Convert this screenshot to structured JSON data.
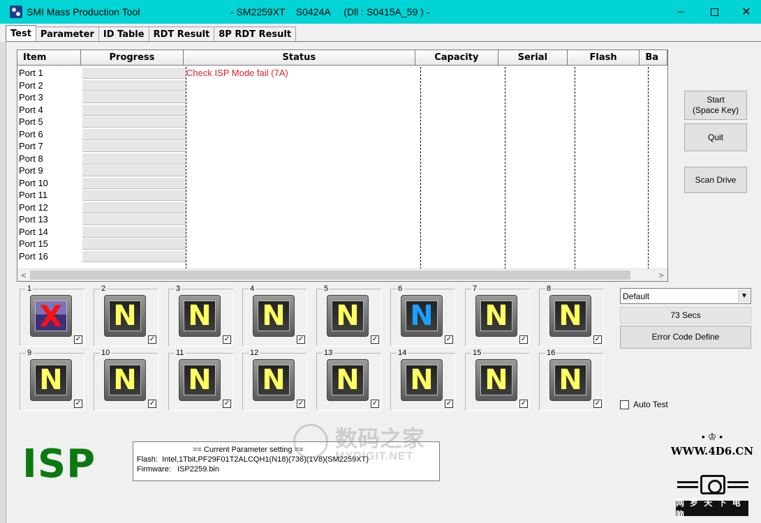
{
  "window": {
    "title": "SMI Mass Production Tool",
    "title_info": "- SM2259XT    S0424A     (Dll : S0415A_59 ) -",
    "minimize": "–",
    "close": "✕"
  },
  "tabs": [
    "Test",
    "Parameter",
    "ID Table",
    "RDT Result",
    "8P RDT Result"
  ],
  "grid": {
    "columns": [
      "Item",
      "Progress",
      "Status",
      "Capacity",
      "Serial",
      "Flash",
      "Ba"
    ],
    "rows": [
      {
        "item": "Port 1",
        "status": "Check ISP Mode fail (7A)"
      },
      {
        "item": "Port 2",
        "status": ""
      },
      {
        "item": "Port 3",
        "status": ""
      },
      {
        "item": "Port 4",
        "status": ""
      },
      {
        "item": "Port 5",
        "status": ""
      },
      {
        "item": "Port 6",
        "status": ""
      },
      {
        "item": "Port 7",
        "status": ""
      },
      {
        "item": "Port 8",
        "status": ""
      },
      {
        "item": "Port 9",
        "status": ""
      },
      {
        "item": "Port 10",
        "status": ""
      },
      {
        "item": "Port 11",
        "status": ""
      },
      {
        "item": "Port 12",
        "status": ""
      },
      {
        "item": "Port 13",
        "status": ""
      },
      {
        "item": "Port 14",
        "status": ""
      },
      {
        "item": "Port 15",
        "status": ""
      },
      {
        "item": "Port 16",
        "status": ""
      }
    ],
    "scroll_left": "<",
    "scroll_right": ">"
  },
  "buttons": {
    "start_line1": "Start",
    "start_line2": "(Space Key)",
    "quit": "Quit",
    "scan": "Scan Drive",
    "error_code": "Error Code Define"
  },
  "slots": [
    {
      "num": "1",
      "mark": "X",
      "state": "fail"
    },
    {
      "num": "2",
      "mark": "N",
      "state": "normal"
    },
    {
      "num": "3",
      "mark": "N",
      "state": "normal"
    },
    {
      "num": "4",
      "mark": "N",
      "state": "normal"
    },
    {
      "num": "5",
      "mark": "N",
      "state": "normal"
    },
    {
      "num": "6",
      "mark": "N",
      "state": "blue"
    },
    {
      "num": "7",
      "mark": "N",
      "state": "normal"
    },
    {
      "num": "8",
      "mark": "N",
      "state": "normal"
    },
    {
      "num": "9",
      "mark": "N",
      "state": "normal"
    },
    {
      "num": "10",
      "mark": "N",
      "state": "normal"
    },
    {
      "num": "11",
      "mark": "N",
      "state": "normal"
    },
    {
      "num": "12",
      "mark": "N",
      "state": "normal"
    },
    {
      "num": "13",
      "mark": "N",
      "state": "normal"
    },
    {
      "num": "14",
      "mark": "N",
      "state": "normal"
    },
    {
      "num": "15",
      "mark": "N",
      "state": "normal"
    },
    {
      "num": "16",
      "mark": "N",
      "state": "normal"
    }
  ],
  "slot_check": "✓",
  "combo": {
    "value": "Default",
    "arrow": "▼"
  },
  "timer": "73 Secs",
  "auto_test": "Auto Test",
  "mode_label": "ISP",
  "params": {
    "header": "== Current Parameter setting ==",
    "flash_label": "Flash:",
    "flash_value": "Intel,1Tbit,PF29F01T2ALCQH1(N18)(736)(1V8)(SM2259XT)",
    "firmware_label": "Firmware:",
    "firmware_value": "ISP2259.bin"
  },
  "watermark": {
    "text": "数码之家",
    "sub": "MYDIGIT.NET"
  },
  "logo": {
    "crown": "• ♔ •",
    "url": "WWW.4D6.CN",
    "banner": "网 罗 天 下 电 脑"
  }
}
